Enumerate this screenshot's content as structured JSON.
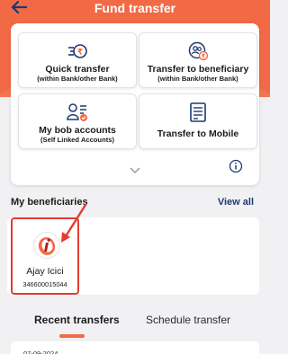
{
  "header": {
    "title": "Fund transfer"
  },
  "tiles": [
    {
      "label": "Quick transfer",
      "sub": "(within Bank/other Bank)"
    },
    {
      "label": "Transfer to beneficiary",
      "sub": "(within Bank/other Bank)"
    },
    {
      "label": "My bob accounts",
      "sub": "(Self Linked Accounts)"
    },
    {
      "label": "Transfer to Mobile",
      "sub": ""
    }
  ],
  "beneficiaries": {
    "title": "My beneficiaries",
    "view_all": "View all",
    "items": [
      {
        "name": "Ajay Icici",
        "account": "346600015044"
      }
    ]
  },
  "tabs": {
    "recent": "Recent transfers",
    "schedule": "Schedule transfer",
    "active": "recent"
  },
  "recent": {
    "date": "07-09-2024"
  },
  "colors": {
    "accent": "#f26a45",
    "navy": "#1d3a6e",
    "highlight": "#e53a2f"
  }
}
